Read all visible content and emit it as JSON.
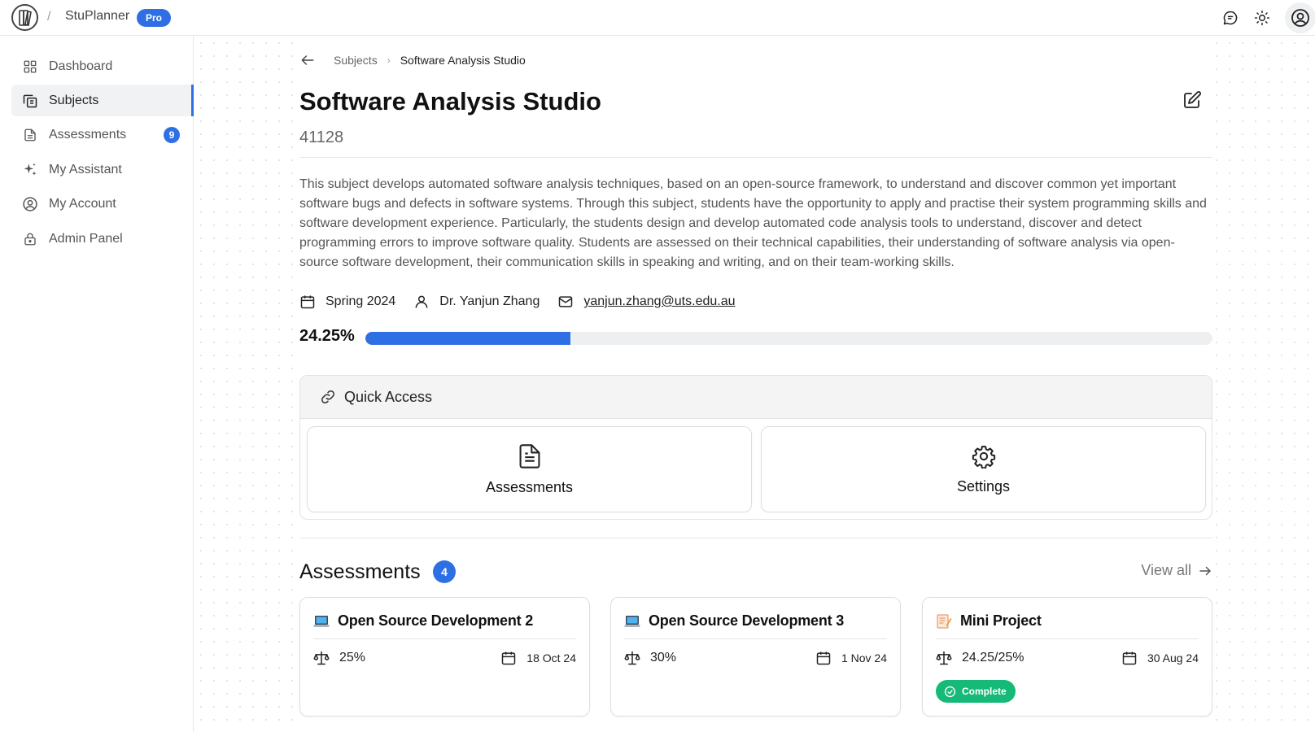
{
  "topbar": {
    "app_name": "StuPlanner",
    "plan_badge": "Pro",
    "separator": "/"
  },
  "sidebar": {
    "items": [
      {
        "label": "Dashboard",
        "icon": "dashboard-grid-icon",
        "active": false
      },
      {
        "label": "Subjects",
        "icon": "subjects-copy-icon",
        "active": true
      },
      {
        "label": "Assessments",
        "icon": "document-icon",
        "active": false,
        "badge": "9"
      },
      {
        "label": "My Assistant",
        "icon": "sparkles-icon",
        "active": false
      },
      {
        "label": "My Account",
        "icon": "user-circle-icon",
        "active": false
      },
      {
        "label": "Admin Panel",
        "icon": "lock-icon",
        "active": false
      }
    ]
  },
  "breadcrumb": {
    "parent": "Subjects",
    "current": "Software Analysis Studio"
  },
  "subject": {
    "title": "Software Analysis Studio",
    "code": "41128",
    "description": "This subject develops automated software analysis techniques, based on an open-source framework, to understand and discover common yet important software bugs and defects in software systems. Through this subject, students have the opportunity to apply and practise their system programming skills and software development experience. Particularly, the students design and develop automated code analysis tools to understand, discover and detect programming errors to improve software quality. Students are assessed on their technical capabilities, their understanding of software analysis via open-source software development, their communication skills in speaking and writing, and on their team-working skills.",
    "session": "Spring 2024",
    "coordinator": "Dr. Yanjun Zhang",
    "email": "yanjun.zhang@uts.edu.au",
    "progress_label": "24.25%",
    "progress_fraction": 0.2425
  },
  "quick_access": {
    "title": "Quick Access",
    "items": [
      {
        "label": "Assessments",
        "icon": "document-icon"
      },
      {
        "label": "Settings",
        "icon": "gear-icon"
      }
    ]
  },
  "assessments": {
    "title": "Assessments",
    "count": "4",
    "view_all": "View all",
    "cards": [
      {
        "emoji": "laptop",
        "title": "Open Source Development 2",
        "weight": "25%",
        "due": "18 Oct 24"
      },
      {
        "emoji": "laptop",
        "title": "Open Source Development 3",
        "weight": "30%",
        "due": "1 Nov 24"
      },
      {
        "emoji": "memo",
        "title": "Mini Project",
        "weight": "24.25/25%",
        "due": "30 Aug 24",
        "status": "Complete"
      }
    ]
  },
  "colors": {
    "accent": "#2f6fe4",
    "success": "#16b978"
  }
}
